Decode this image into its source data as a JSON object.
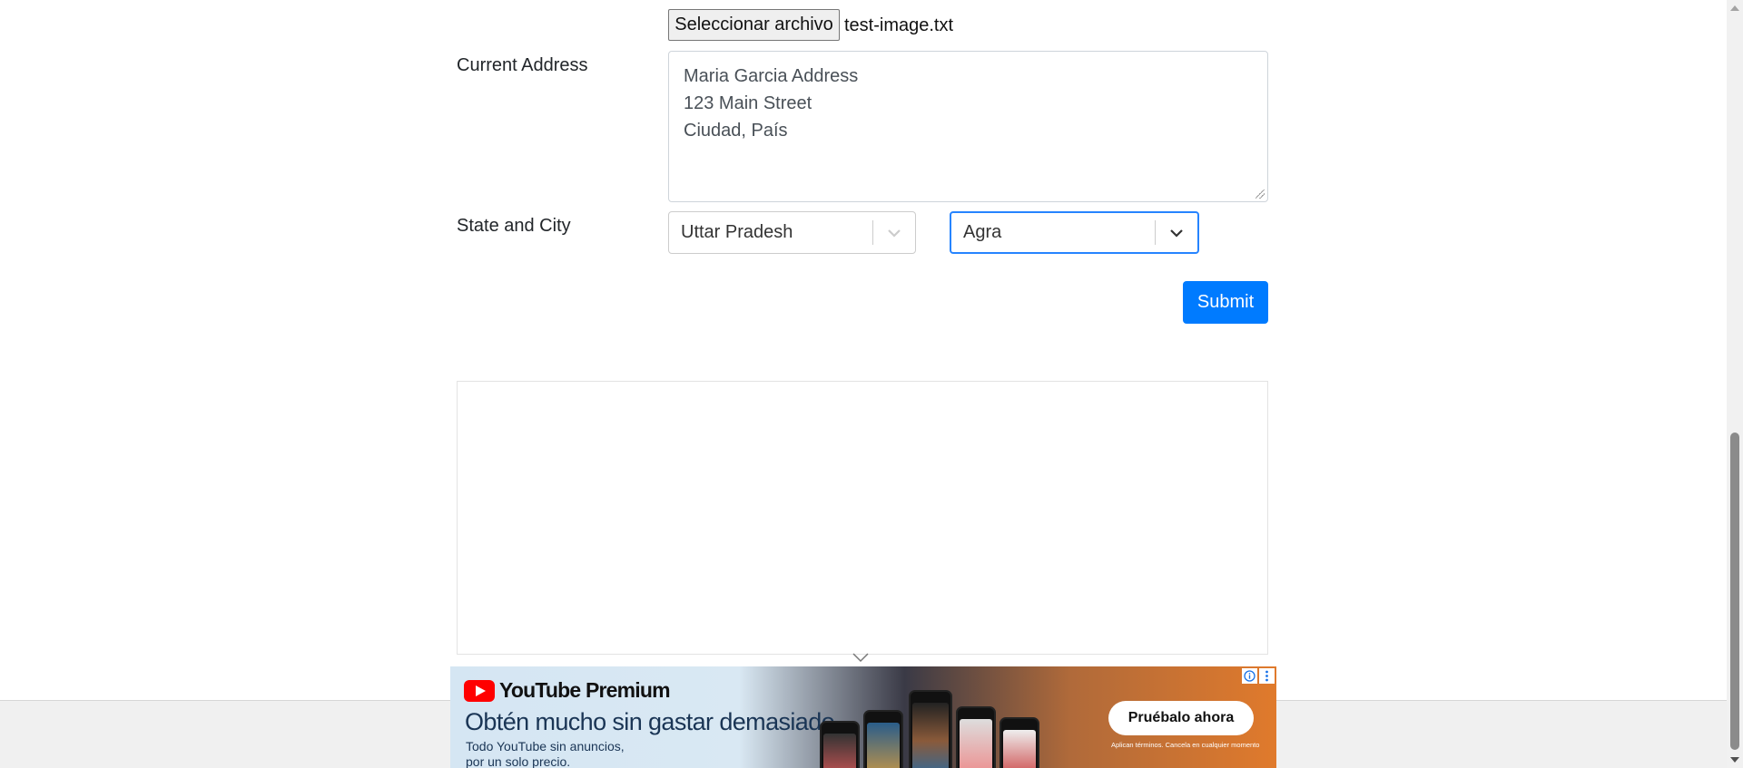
{
  "form": {
    "file_button_label": "Seleccionar archivo",
    "file_name": "test-image.txt",
    "current_address_label": "Current Address",
    "address_lines": [
      "Maria Garcia Address",
      "123 Main Street",
      "Ciudad, País"
    ],
    "state_city_label": "State and City",
    "state_value": "Uttar Pradesh",
    "city_value": "Agra",
    "submit_label": "Submit"
  },
  "ad": {
    "brand": "YouTube Premium",
    "headline": "Obtén mucho sin gastar demasiado.",
    "sub_line_1": "Todo YouTube sin anuncios,",
    "sub_line_2": "por un solo precio.",
    "cta_label": "Pruébalo ahora",
    "legal_text": "Aplican términos. Cancela en cualquier momento",
    "colors": {
      "yt_red": "#ff0000",
      "headline": "#1a3555",
      "accent_orange": "#e07a2c"
    }
  },
  "colors": {
    "primary_button": "#007bff",
    "focus_border": "#2684ff",
    "input_border": "#ced4da"
  },
  "icons": {
    "select_chevron": "chevron-down-icon",
    "ad_info": "info-icon",
    "ad_menu": "kebab-menu-icon",
    "collapse": "chevron-down-icon"
  }
}
